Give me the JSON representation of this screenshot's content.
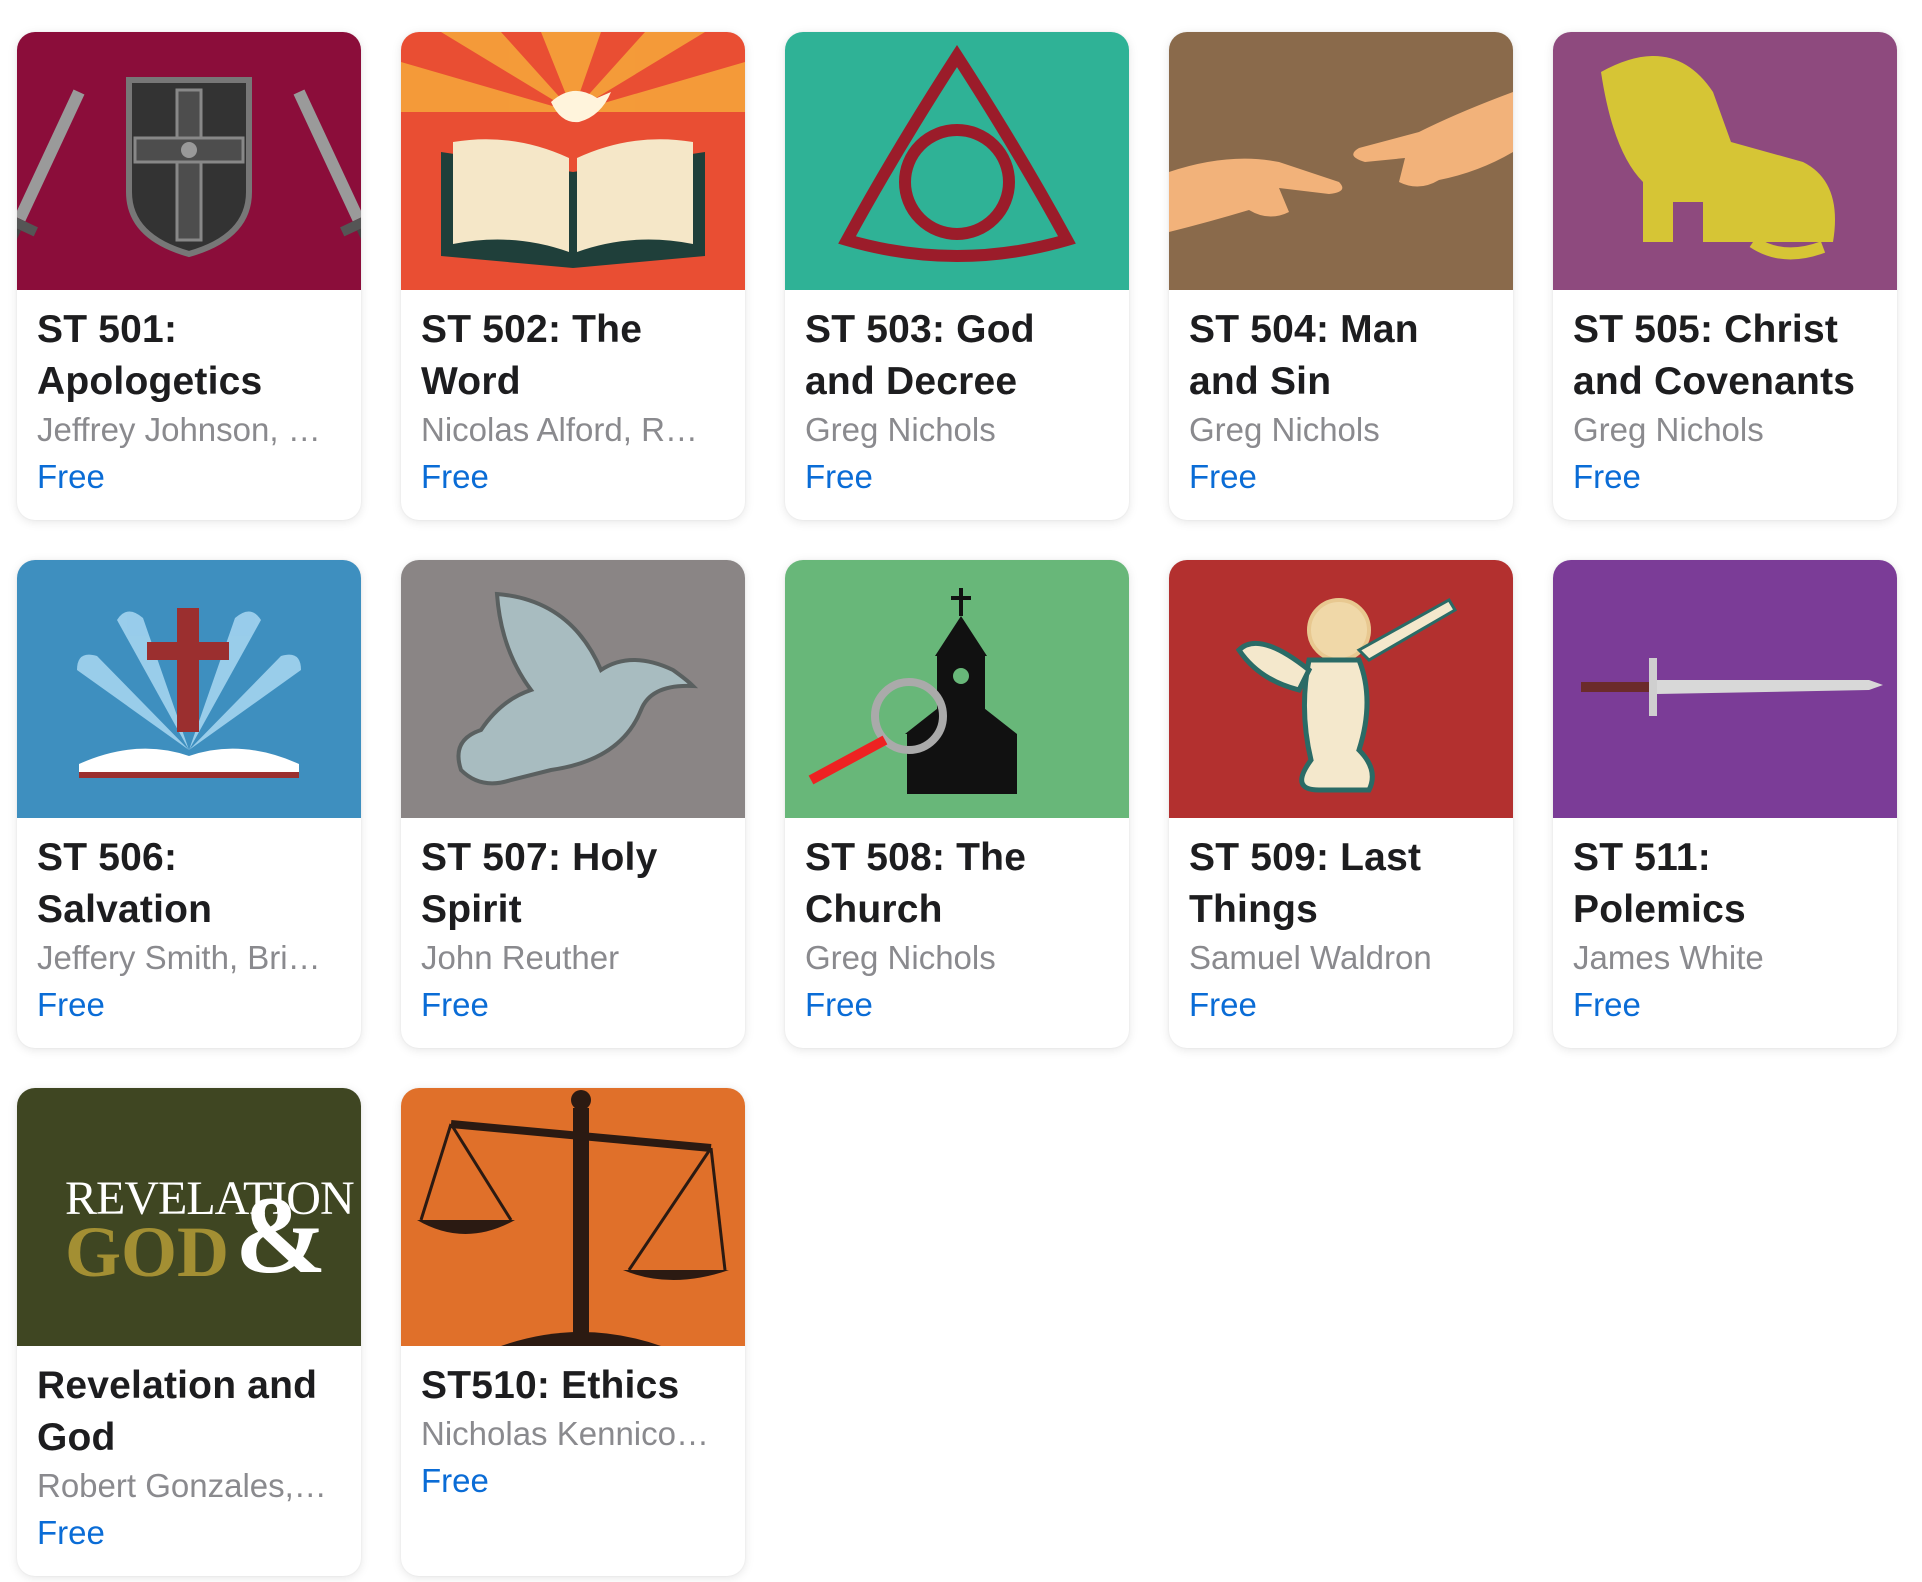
{
  "courses": [
    {
      "title": "ST 501: Apologetics",
      "author": "Jeffrey Johnson, …",
      "price": "Free",
      "art_icon": "shield-swords-icon",
      "bg": "#8b0d3a"
    },
    {
      "title": "ST 502: The Word",
      "author": "Nicolas Alford, R…",
      "price": "Free",
      "art_icon": "bible-dove-icon",
      "bg": "#e94e33"
    },
    {
      "title": "ST 503: God and Decree",
      "author": "Greg Nichols",
      "price": "Free",
      "art_icon": "trinity-knot-icon",
      "bg": "#2fb296"
    },
    {
      "title": "ST 504: Man and Sin",
      "author": "Greg Nichols",
      "price": "Free",
      "art_icon": "creation-hands-icon",
      "bg": "#8a6a4b"
    },
    {
      "title": "ST 505: Christ and Covenants",
      "author": "Greg Nichols",
      "price": "Free",
      "art_icon": "lion-lamb-icon",
      "bg": "#8e4a7e"
    },
    {
      "title": "ST 506: Salvation",
      "author": "Jeffery Smith, Bri…",
      "price": "Free",
      "art_icon": "cross-book-icon",
      "bg": "#3e8fbf"
    },
    {
      "title": "ST 507: Holy Spirit",
      "author": "John Reuther",
      "price": "Free",
      "art_icon": "dove-icon",
      "bg": "#8a8585"
    },
    {
      "title": "ST 508: The Church",
      "author": "Greg Nichols",
      "price": "Free",
      "art_icon": "church-magnifier-icon",
      "bg": "#68b779"
    },
    {
      "title": "ST 509: Last Things",
      "author": "Samuel Waldron",
      "price": "Free",
      "art_icon": "angel-trumpet-icon",
      "bg": "#b3302f"
    },
    {
      "title": "ST 511: Polemics",
      "author": "James White",
      "price": "Free",
      "art_icon": "sword-icon",
      "bg": "#7b3c97"
    },
    {
      "title": "Revelation and God",
      "author": "Robert Gonzales,…",
      "price": "Free",
      "art_icon": "revelation-god-logo",
      "bg": "#3f4622",
      "logo_text": {
        "line1": "REVELATION",
        "line2": "GOD",
        "amp": "&"
      }
    },
    {
      "title": "ST510: Ethics",
      "author": "Nicholas Kennico…",
      "price": "Free",
      "art_icon": "scales-icon",
      "bg": "#e0702a"
    }
  ]
}
